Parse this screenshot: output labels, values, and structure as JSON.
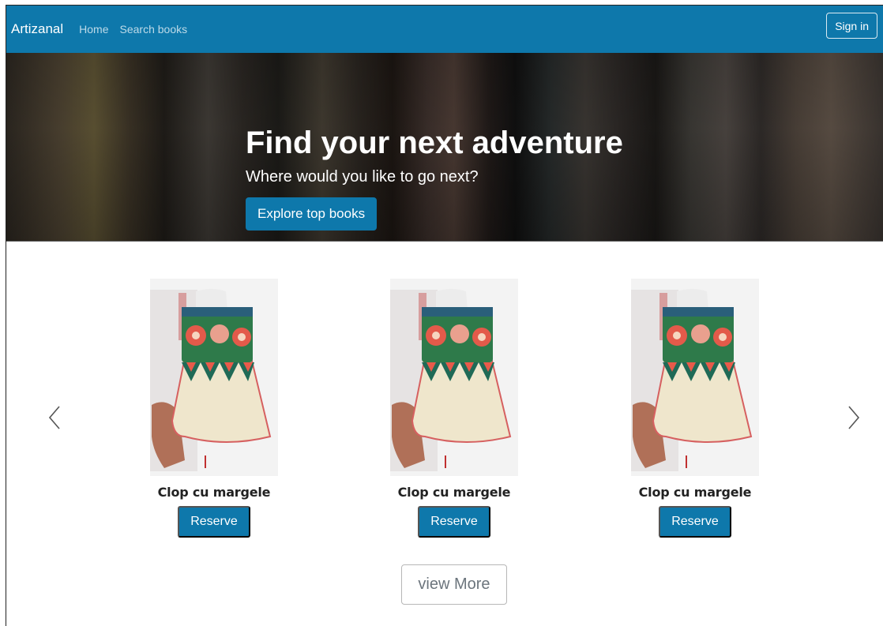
{
  "navbar": {
    "brand": "Artizanal",
    "links": [
      "Home",
      "Search books"
    ],
    "signin_label": "Sign in",
    "color": "#0e78ab"
  },
  "hero": {
    "title": "Find your next adventure",
    "subtitle": "Where would you like to go next?",
    "button_label": "Explore top books"
  },
  "carousel": {
    "prev_icon": "chevron-left-icon",
    "next_icon": "chevron-right-icon",
    "products": [
      {
        "title": "Clop cu margele",
        "button_label": "Reserve",
        "image": "embroidered-hat"
      },
      {
        "title": "Clop cu margele",
        "button_label": "Reserve",
        "image": "embroidered-hat"
      },
      {
        "title": "Clop cu margele",
        "button_label": "Reserve",
        "image": "embroidered-hat"
      }
    ],
    "view_more_label": "view More"
  }
}
